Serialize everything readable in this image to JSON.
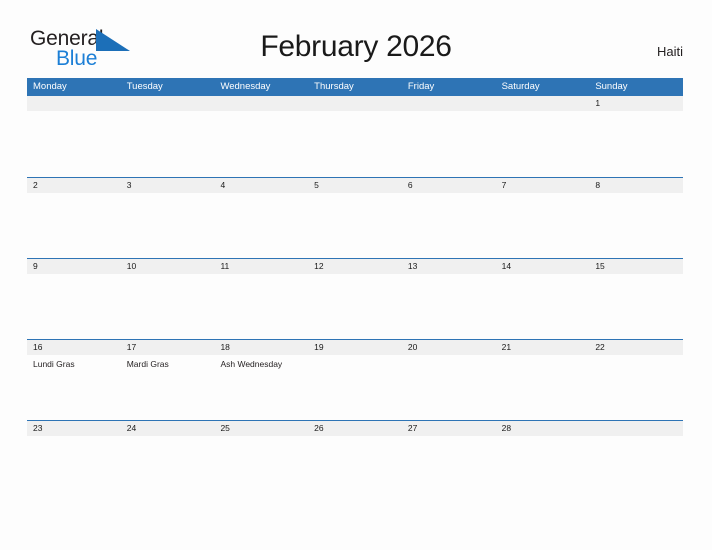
{
  "brand": {
    "name_part1": "General",
    "name_part2": "Blue",
    "flag_icon": "blue-triangle-flag-icon"
  },
  "header": {
    "title": "February 2026",
    "country": "Haiti"
  },
  "calendar": {
    "weekday_headers": [
      "Monday",
      "Tuesday",
      "Wednesday",
      "Thursday",
      "Friday",
      "Saturday",
      "Sunday"
    ],
    "colors": {
      "header_blue": "#2e74b5",
      "band_gray": "#f0f0f0",
      "brand_blue": "#1c7fd6",
      "text_dark": "#231f20",
      "page_background": "#fdfdfd"
    },
    "weeks": [
      [
        {
          "date": "",
          "events": []
        },
        {
          "date": "",
          "events": []
        },
        {
          "date": "",
          "events": []
        },
        {
          "date": "",
          "events": []
        },
        {
          "date": "",
          "events": []
        },
        {
          "date": "",
          "events": []
        },
        {
          "date": "1",
          "events": []
        }
      ],
      [
        {
          "date": "2",
          "events": []
        },
        {
          "date": "3",
          "events": []
        },
        {
          "date": "4",
          "events": []
        },
        {
          "date": "5",
          "events": []
        },
        {
          "date": "6",
          "events": []
        },
        {
          "date": "7",
          "events": []
        },
        {
          "date": "8",
          "events": []
        }
      ],
      [
        {
          "date": "9",
          "events": []
        },
        {
          "date": "10",
          "events": []
        },
        {
          "date": "11",
          "events": []
        },
        {
          "date": "12",
          "events": []
        },
        {
          "date": "13",
          "events": []
        },
        {
          "date": "14",
          "events": []
        },
        {
          "date": "15",
          "events": []
        }
      ],
      [
        {
          "date": "16",
          "events": [
            "Lundi Gras"
          ]
        },
        {
          "date": "17",
          "events": [
            "Mardi Gras"
          ]
        },
        {
          "date": "18",
          "events": [
            "Ash Wednesday"
          ]
        },
        {
          "date": "19",
          "events": []
        },
        {
          "date": "20",
          "events": []
        },
        {
          "date": "21",
          "events": []
        },
        {
          "date": "22",
          "events": []
        }
      ],
      [
        {
          "date": "23",
          "events": []
        },
        {
          "date": "24",
          "events": []
        },
        {
          "date": "25",
          "events": []
        },
        {
          "date": "26",
          "events": []
        },
        {
          "date": "27",
          "events": []
        },
        {
          "date": "28",
          "events": []
        },
        {
          "date": "",
          "events": []
        }
      ]
    ]
  }
}
